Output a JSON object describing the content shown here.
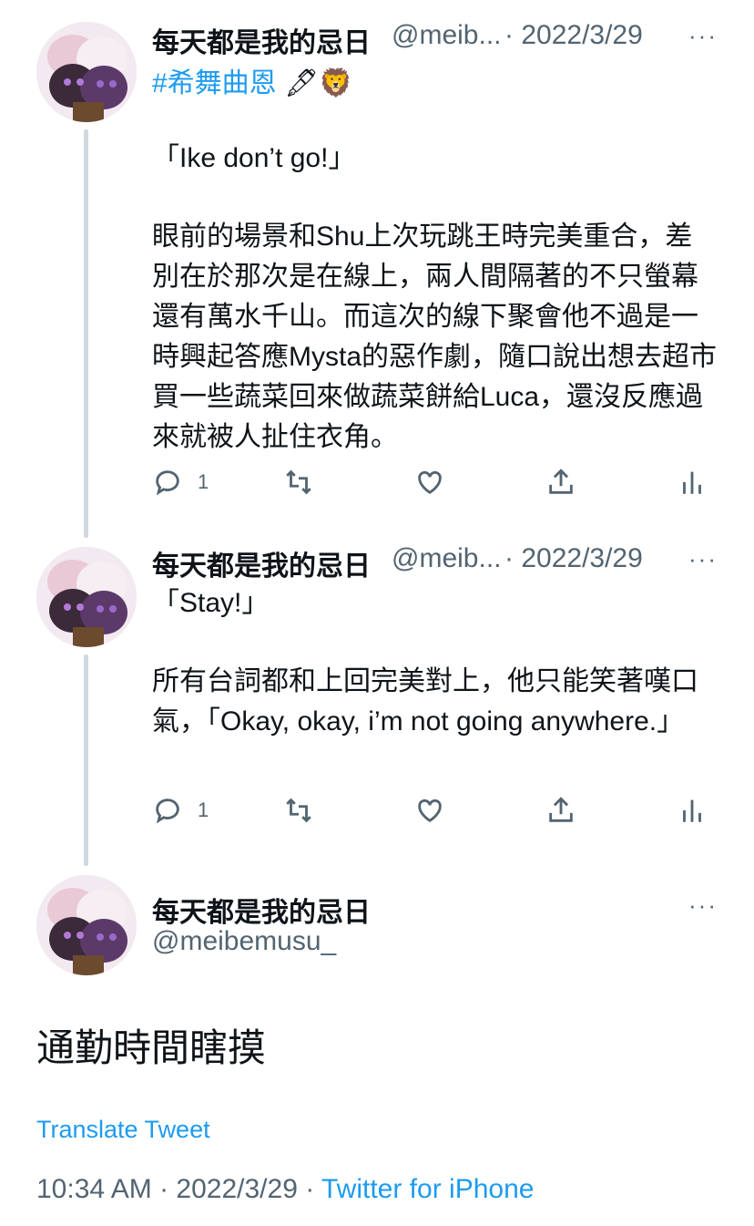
{
  "tweets": [
    {
      "author_name": "每天都是我的忌日",
      "handle_short": "@meib...",
      "date": "· 2022/3/29",
      "more": "···",
      "hashtag": "#希舞曲恩",
      "emoji": "🖋🦁",
      "paragraphs": [
        "「Ike don’t go!」",
        "眼前的場景和Shu上次玩跳王時完美重合，差別在於那次是在線上，兩人間隔著的不只螢幕還有萬水千山。而這次的線下聚會他不過是一時興起答應Mysta的惡作劇，隨口說出想去超市買一些蔬菜回來做蔬菜餅給Luca，還沒反應過來就被人扯住衣角。"
      ],
      "reply_count": "1"
    },
    {
      "author_name": "每天都是我的忌日",
      "handle_short": "@meib...",
      "date": "· 2022/3/29",
      "more": "···",
      "paragraphs": [
        "「Stay!」",
        "所有台詞都和上回完美對上，他只能笑著嘆口氣，「Okay, okay, i’m not going anywhere.」"
      ],
      "reply_count": "1"
    }
  ],
  "main_tweet": {
    "author_name": "每天都是我的忌日",
    "handle": "@meibemusu_",
    "more": "···",
    "text": "通勤時間瞎摸",
    "translate": "Translate Tweet",
    "timestamp": "10:34 AM · 2022/3/29 · ",
    "source": "Twitter for iPhone"
  },
  "colors": {
    "link": "#1d9bf0",
    "muted": "#536471",
    "text": "#0f1419",
    "line": "#cfd9de"
  }
}
